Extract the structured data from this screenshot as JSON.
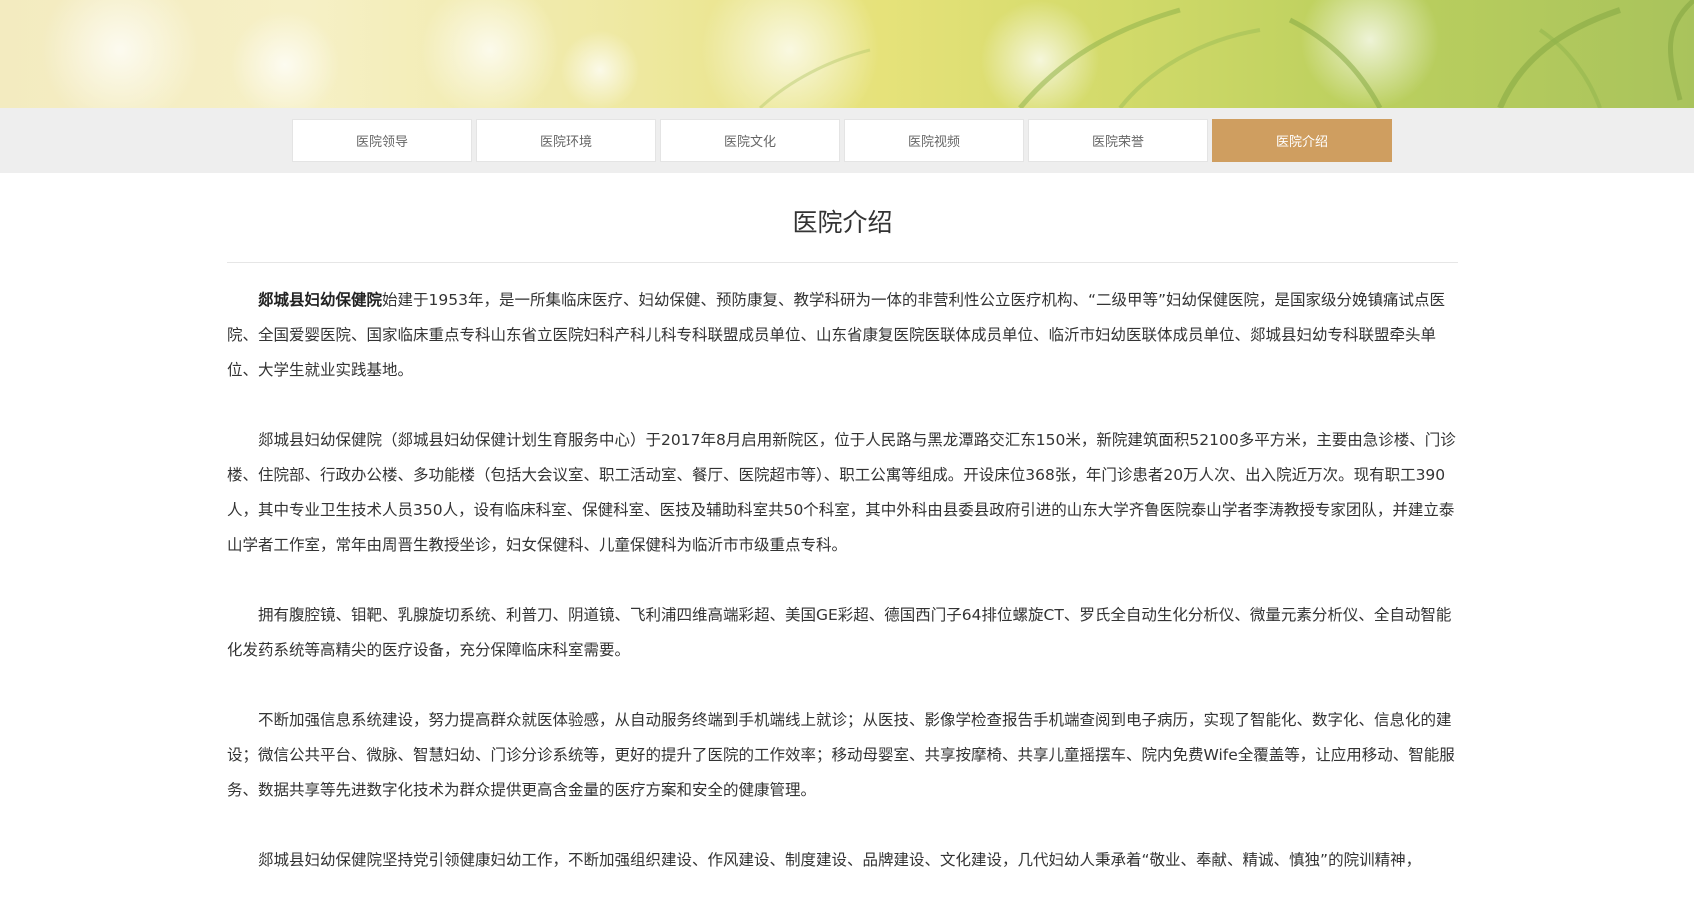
{
  "nav": {
    "tabs": [
      {
        "label": "医院领导",
        "active": false
      },
      {
        "label": "医院环境",
        "active": false
      },
      {
        "label": "医院文化",
        "active": false
      },
      {
        "label": "医院视频",
        "active": false
      },
      {
        "label": "医院荣誉",
        "active": false
      },
      {
        "label": "医院介绍",
        "active": true
      }
    ],
    "active_color": "#cf9e60"
  },
  "page": {
    "title": "医院介绍"
  },
  "article": {
    "p1_bold": "郯城县妇幼保健院",
    "p1_rest": "始建于1953年，是一所集临床医疗、妇幼保健、预防康复、教学科研为一体的非营利性公立医疗机构、“二级甲等”妇幼保健医院，是国家级分娩镇痛试点医院、全国爱婴医院、国家临床重点专科山东省立医院妇科产科儿科专科联盟成员单位、山东省康复医院医联体成员单位、临沂市妇幼医联体成员单位、郯城县妇幼专科联盟牵头单位、大学生就业实践基地。",
    "p2": "郯城县妇幼保健院（郯城县妇幼保健计划生育服务中心）于2017年8月启用新院区，位于人民路与黑龙潭路交汇东150米，新院建筑面积52100多平方米，主要由急诊楼、门诊楼、住院部、行政办公楼、多功能楼（包括大会议室、职工活动室、餐厅、医院超市等）、职工公寓等组成。开设床位368张，年门诊患者20万人次、出入院近万次。现有职工390人，其中专业卫生技术人员350人，设有临床科室、保健科室、医技及辅助科室共50个科室，其中外科由县委县政府引进的山东大学齐鲁医院泰山学者李涛教授专家团队，并建立泰山学者工作室，常年由周晋生教授坐诊，妇女保健科、儿童保健科为临沂市市级重点专科。",
    "p3": "拥有腹腔镜、钼靶、乳腺旋切系统、利普刀、阴道镜、飞利浦四维高端彩超、美国GE彩超、德国西门子64排位螺旋CT、罗氏全自动生化分析仪、微量元素分析仪、全自动智能化发药系统等高精尖的医疗设备，充分保障临床科室需要。",
    "p4": "不断加强信息系统建设，努力提高群众就医体验感，从自动服务终端到手机端线上就诊；从医技、影像学检查报告手机端查阅到电子病历，实现了智能化、数字化、信息化的建设；微信公共平台、微脉、智慧妇幼、门诊分诊系统等，更好的提升了医院的工作效率；移动母婴室、共享按摩椅、共享儿童摇摆车、院内免费Wife全覆盖等，让应用移动、智能服务、数据共享等先进数字化技术为群众提供更高含金量的医疗方案和安全的健康管理。",
    "p5": "郯城县妇幼保健院坚持党引领健康妇幼工作，不断加强组织建设、作风建设、制度建设、品牌建设、文化建设，几代妇幼人秉承着“敬业、奉献、精诚、慎独”的院训精神，"
  }
}
